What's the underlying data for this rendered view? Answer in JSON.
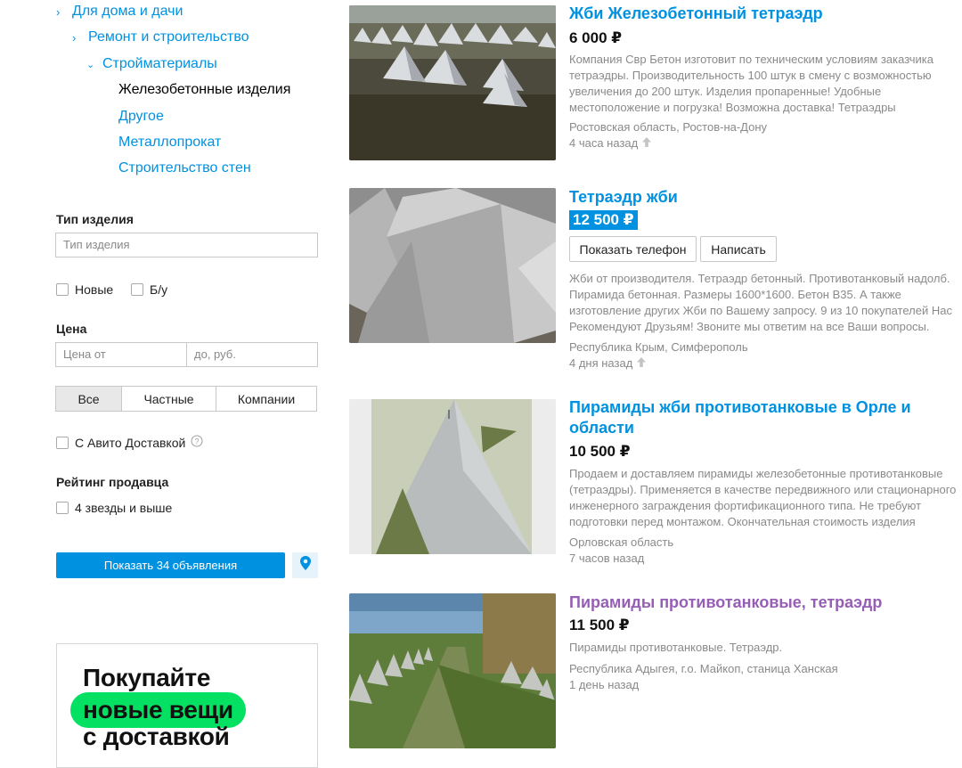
{
  "sidebar": {
    "categories": [
      {
        "label": "Для дома и дачи"
      },
      {
        "label": "Ремонт и строительство"
      },
      {
        "label": "Стройматериалы"
      },
      {
        "label": "Железобетонные изделия"
      },
      {
        "label": "Другое"
      },
      {
        "label": "Металлопрокат"
      },
      {
        "label": "Строительство стен"
      }
    ],
    "product_type_label": "Тип изделия",
    "product_type_placeholder": "Тип изделия",
    "condition_new": "Новые",
    "condition_used": "Б/у",
    "price_label": "Цена",
    "price_from_placeholder": "Цена от",
    "price_to_placeholder": "до, руб.",
    "seller_tabs": [
      "Все",
      "Частные",
      "Компании"
    ],
    "seller_tab_selected": "Все",
    "avito_delivery_label": "С Авито Доставкой",
    "rating_label": "Рейтинг продавца",
    "rating_option": "4 звезды и выше",
    "show_button": "Показать 34 объявления"
  },
  "banner": {
    "line1": "Покупайте",
    "line2": "новые вещи",
    "line3": "с доставкой",
    "accent": "#04e061"
  },
  "listings": [
    {
      "title": "Жби Железобетонный тетраэдр",
      "price": "6 000 ₽",
      "description": [
        "Компания Свр Бетон изготовит по техническим условиям заказчика",
        "тетраэдры. Производительность 100 штук в смену с возможностью",
        "увеличения до 200 штук. Изделия пропаренные! Удобные",
        "местоположение и погрузка! Возможна доставка! Тетраэдры"
      ],
      "location": "Ростовская область, Ростов-на-Дону",
      "time": "4 часа назад"
    },
    {
      "title": "Тетраэдр жби",
      "price": "12 500 ₽",
      "show_phone": "Показать телефон",
      "write": "Написать",
      "description": [
        "Жби от производителя. Тетраэдр бетонный. Противотанковый надолб.",
        "Пирамида бетонная. Размеры 1600*1600. Бетон В35. А также",
        "изготовление других Жби по Вашему запросу. 9 из 10 покупателей Нас",
        "Рекомендуют Друзьям! Звоните мы ответим на все Ваши вопросы."
      ],
      "location": "Республика Крым, Симферополь",
      "time": "4 дня назад"
    },
    {
      "title_line1": "Пирамиды жби противотанковые в Орле и",
      "title_line2": "области",
      "price": "10 500 ₽",
      "description": [
        "Продаем и доставляем пирамиды железобетонные противотанковые",
        "(тетраэдры). Применяется в качестве передвижного или стационарного",
        "инженерного заграждения фортификационного типа. Не требуют",
        "подготовки перед монтажом. Окончательная стоимость изделия"
      ],
      "location": "Орловская область",
      "time": "7 часов назад"
    },
    {
      "title": "Пирамиды противотанковые, тетраэдр",
      "price": "11 500 ₽",
      "description": [
        "Пирамиды противотанковые. Тетраэдр."
      ],
      "location": "Республика Адыгея, г.о. Майкоп, станица Ханская",
      "time": "1 день назад"
    }
  ],
  "colors": {
    "link": "#0091e0",
    "visited_link": "#965eb5",
    "muted_text": "#8a8a8a"
  }
}
